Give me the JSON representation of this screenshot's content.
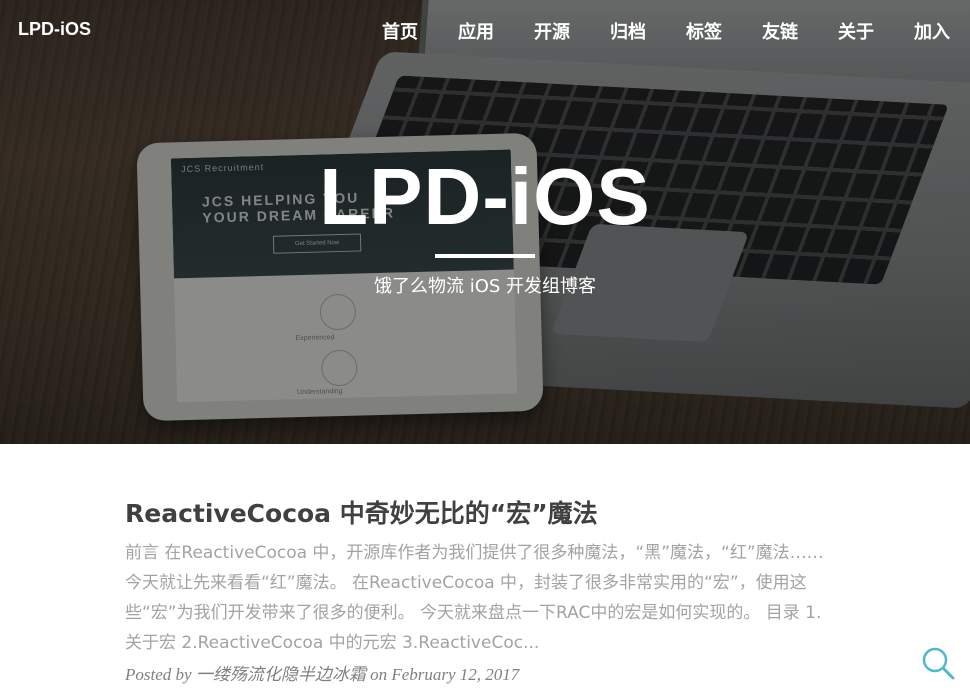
{
  "header": {
    "brand": "LPD-iOS",
    "nav": [
      "首页",
      "应用",
      "开源",
      "归档",
      "标签",
      "友链",
      "关于",
      "加入"
    ]
  },
  "hero": {
    "title": "LPD-iOS",
    "subtitle": "饿了么物流 iOS 开发组博客",
    "tablet_brand": "JCS Recruitment",
    "tablet_headline_1": "JCS HELPING YOU",
    "tablet_headline_2": "YOUR DREAM CAREER",
    "tablet_cta": "Get Started Now",
    "tablet_label_1": "Experienced",
    "tablet_label_2": "Understanding"
  },
  "post": {
    "title": "ReactiveCocoa 中奇妙无比的“宏”魔法",
    "excerpt": "前言 在ReactiveCocoa 中，开源库作者为我们提供了很多种魔法，“黑”魔法，“红”魔法……今天就让先来看看“红”魔法。 在ReactiveCocoa 中，封装了很多非常实用的“宏”，使用这些“宏”为我们开发带来了很多的便利。 今天就来盘点一下RAC中的宏是如何实现的。 目录 1.关于宏 2.ReactiveCocoa 中的元宏 3.ReactiveCoc...",
    "meta": "Posted by 一缕殇流化隐半边冰霜 on February 12, 2017"
  },
  "icons": {
    "search": "search-icon",
    "accent_color": "#4fb8cf"
  }
}
